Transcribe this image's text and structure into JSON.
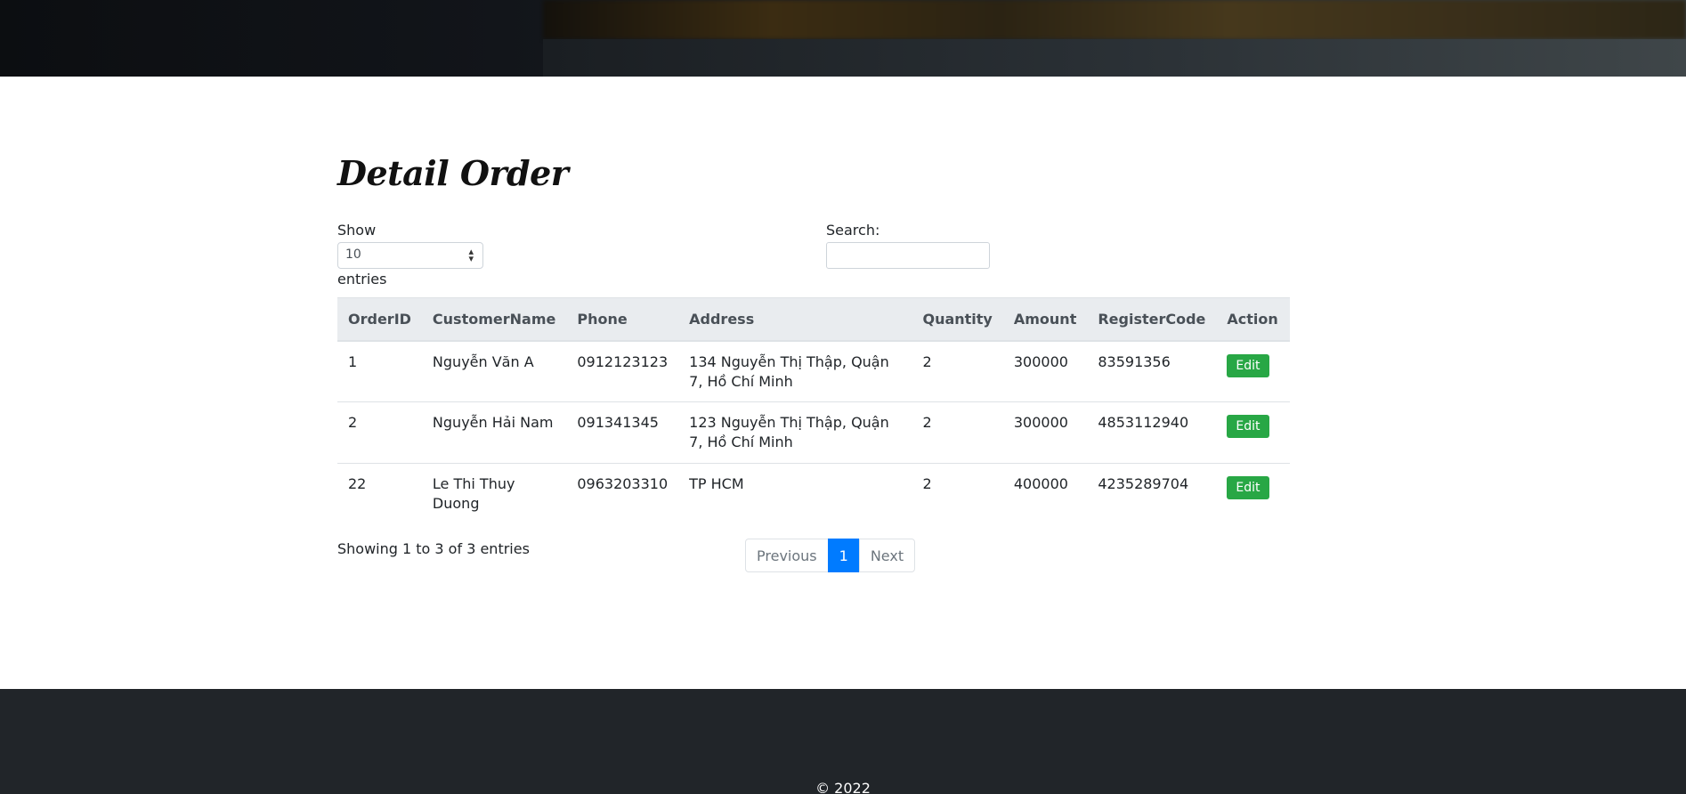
{
  "page": {
    "title": "Detail Order"
  },
  "controls": {
    "show_label": "Show",
    "page_size": "10",
    "entries_label": "entries",
    "search_label": "Search:",
    "search_value": ""
  },
  "table": {
    "headers": [
      "OrderID",
      "CustomerName",
      "Phone",
      "Address",
      "Quantity",
      "Amount",
      "RegisterCode",
      "Action"
    ],
    "rows": [
      {
        "order_id": "1",
        "customer": "Nguyễn Văn A",
        "phone": "0912123123",
        "address": "134 Nguyễn Thị Thập, Quận 7, Hồ Chí Minh",
        "quantity": "2",
        "amount": "300000",
        "register_code": "83591356",
        "action": "Edit"
      },
      {
        "order_id": "2",
        "customer": "Nguyễn Hải Nam",
        "phone": "091341345",
        "address": "123 Nguyễn Thị Thập, Quận 7, Hồ Chí Minh",
        "quantity": "2",
        "amount": "300000",
        "register_code": "4853112940",
        "action": "Edit"
      },
      {
        "order_id": "22",
        "customer": "Le Thi Thuy Duong",
        "phone": "0963203310",
        "address": "TP HCM",
        "quantity": "2",
        "amount": "400000",
        "register_code": "4235289704",
        "action": "Edit"
      }
    ]
  },
  "summary": {
    "info": "Showing 1 to 3 of 3 entries"
  },
  "pagination": {
    "previous": "Previous",
    "current": "1",
    "next": "Next"
  },
  "footer": {
    "copyright": "© 2022"
  },
  "colors": {
    "edit_button": "#28a745",
    "active_page": "#007bff",
    "footer_bg": "#212529",
    "table_header_bg": "#e9ecef"
  }
}
